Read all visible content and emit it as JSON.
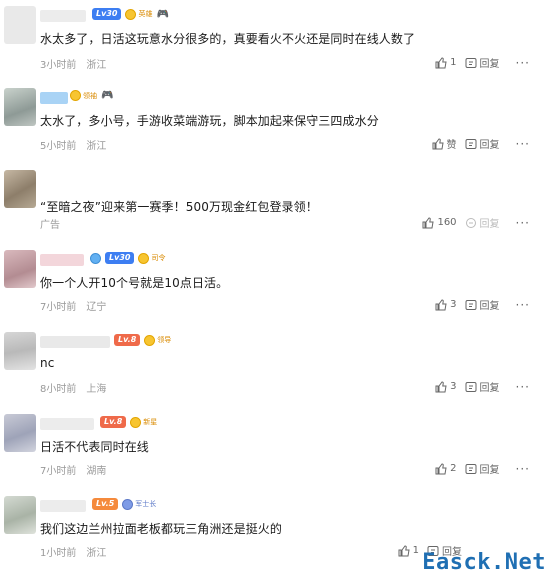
{
  "colors": {
    "text": "#1a1a1a",
    "meta": "#999999",
    "level_blue": "#3d7ef2",
    "level_red": "#ef6a4a",
    "watermark": "#1f6fb3"
  },
  "comments": [
    {
      "level": "Lv30",
      "medal": "英雄",
      "text": "水太多了，日活这玩意水分很多的，真要看火不火还是同时在线人数了",
      "time": "3小时前",
      "location": "浙江",
      "likes": "1",
      "reply": "回复"
    },
    {
      "level": "",
      "medal": "领袖",
      "text": "太水了，多小号，手游收菜端游玩，脚本加起来保守三四成水分",
      "time": "5小时前",
      "location": "浙江",
      "likes": "赞",
      "reply": "回复"
    },
    {
      "level": "",
      "medal": "",
      "text": "“至暗之夜”迎来第一赛季！500万现金红包登录领！",
      "time": "广告",
      "location": "",
      "likes": "160",
      "reply": "回复"
    },
    {
      "level": "Lv30",
      "medal": "司令",
      "text": "你一个人开10个号就是10点日活。",
      "time": "7小时前",
      "location": "辽宁",
      "likes": "3",
      "reply": "回复"
    },
    {
      "level": "Lv.8",
      "medal": "领导",
      "text": "nc",
      "time": "8小时前",
      "location": "上海",
      "likes": "3",
      "reply": "回复"
    },
    {
      "level": "Lv.8",
      "medal": "新星",
      "text": "日活不代表同时在线",
      "time": "7小时前",
      "location": "湖南",
      "likes": "2",
      "reply": "回复"
    },
    {
      "level": "Lv.5",
      "medal": "军士长",
      "text": "我们这边兰州拉面老板都玩三角洲还是挺火的",
      "time": "1小时前",
      "location": "浙江",
      "likes": "1",
      "reply": "回复"
    }
  ],
  "more_label": "···",
  "watermark": "Easck.Net"
}
